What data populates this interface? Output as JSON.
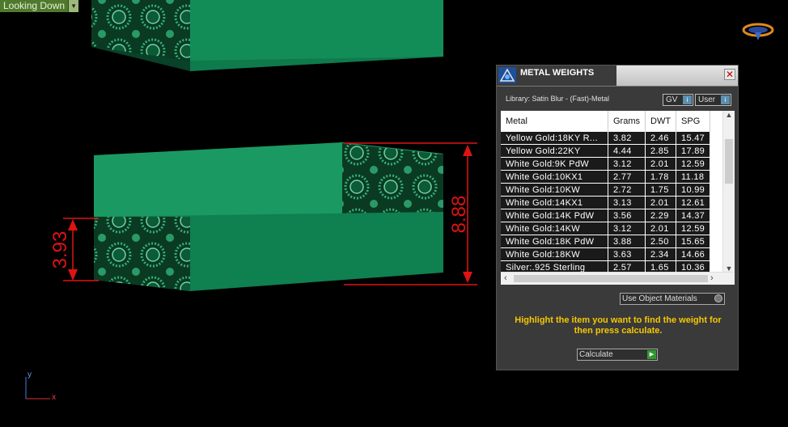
{
  "viewport": {
    "label": "Looking Down",
    "dimension_left": "3.93",
    "dimension_right": "8.88",
    "axis_y": "y",
    "axis_x": "x"
  },
  "colors": {
    "accent_red": "#e01212",
    "model_green": "#128d58",
    "hint_yellow": "#f5c800"
  },
  "panel": {
    "title": "METAL WEIGHTS",
    "library_label": "Library: Satin Blur - (Fast)-Metal",
    "gv_label": "GV",
    "user_label": "User",
    "columns": [
      "Metal",
      "Grams",
      "DWT",
      "SPG"
    ],
    "rows": [
      [
        "Yellow Gold:18KY R...",
        "3.82",
        "2.46",
        "15.47"
      ],
      [
        "Yellow Gold:22KY",
        "4.44",
        "2.85",
        "17.89"
      ],
      [
        "White Gold:9K PdW",
        "3.12",
        "2.01",
        "12.59"
      ],
      [
        "White Gold:10KX1",
        "2.77",
        "1.78",
        "11.18"
      ],
      [
        "White Gold:10KW",
        "2.72",
        "1.75",
        "10.99"
      ],
      [
        "White Gold:14KX1",
        "3.13",
        "2.01",
        "12.61"
      ],
      [
        "White Gold:14K PdW",
        "3.56",
        "2.29",
        "14.37"
      ],
      [
        "White Gold:14KW",
        "3.12",
        "2.01",
        "12.59"
      ],
      [
        "White Gold:18K PdW",
        "3.88",
        "2.50",
        "15.65"
      ],
      [
        "White Gold:18KW",
        "3.63",
        "2.34",
        "14.66"
      ],
      [
        "Silver:.925 Sterling",
        "2.57",
        "1.65",
        "10.36"
      ]
    ],
    "use_object_materials": "Use Object Materials",
    "hint": "Highlight the item you want to find the weight for then press calculate.",
    "calculate": "Calculate"
  }
}
